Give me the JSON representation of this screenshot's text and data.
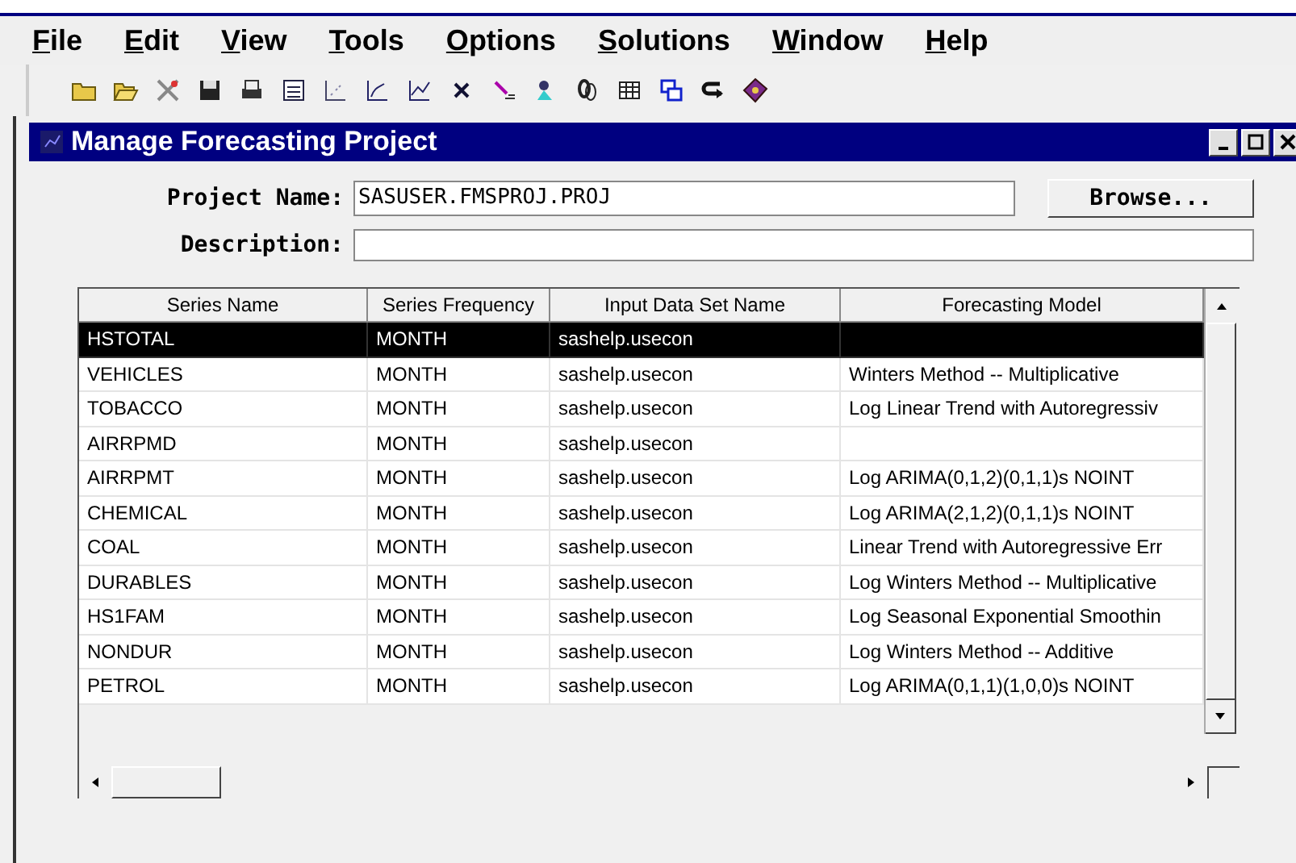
{
  "menu": [
    "File",
    "Edit",
    "View",
    "Tools",
    "Options",
    "Solutions",
    "Window",
    "Help"
  ],
  "window": {
    "title": "Manage Forecasting Project"
  },
  "project_name": {
    "label": "Project Name:",
    "value": "SASUSER.FMSPROJ.PROJ"
  },
  "browse_button": "Browse...",
  "description": {
    "label": "Description:"
  },
  "table": {
    "columns": [
      "Series Name",
      "Series Frequency",
      "Input Data Set Name",
      "Forecasting Model"
    ],
    "rows": [
      {
        "cells": [
          "HSTOTAL",
          "MONTH",
          "sashelp.usecon",
          ""
        ],
        "selected": true
      },
      {
        "cells": [
          "VEHICLES",
          "MONTH",
          "sashelp.usecon",
          "Winters Method -- Multiplicative"
        ],
        "selected": false
      },
      {
        "cells": [
          "TOBACCO",
          "MONTH",
          "sashelp.usecon",
          "Log Linear Trend with Autoregressiv"
        ],
        "selected": false
      },
      {
        "cells": [
          "AIRRPMD",
          "MONTH",
          "sashelp.usecon",
          ""
        ],
        "selected": false
      },
      {
        "cells": [
          "AIRRPMT",
          "MONTH",
          "sashelp.usecon",
          "Log ARIMA(0,1,2)(0,1,1)s NOINT"
        ],
        "selected": false
      },
      {
        "cells": [
          "CHEMICAL",
          "MONTH",
          "sashelp.usecon",
          "Log ARIMA(2,1,2)(0,1,1)s NOINT"
        ],
        "selected": false
      },
      {
        "cells": [
          "COAL",
          "MONTH",
          "sashelp.usecon",
          "Linear Trend with Autoregressive Err"
        ],
        "selected": false
      },
      {
        "cells": [
          "DURABLES",
          "MONTH",
          "sashelp.usecon",
          "Log Winters Method -- Multiplicative"
        ],
        "selected": false
      },
      {
        "cells": [
          "HS1FAM",
          "MONTH",
          "sashelp.usecon",
          "Log Seasonal Exponential Smoothin"
        ],
        "selected": false
      },
      {
        "cells": [
          "NONDUR",
          "MONTH",
          "sashelp.usecon",
          "Log Winters Method -- Additive"
        ],
        "selected": false
      },
      {
        "cells": [
          "PETROL",
          "MONTH",
          "sashelp.usecon",
          "Log ARIMA(0,1,1)(1,0,0)s NOINT"
        ],
        "selected": false
      }
    ]
  }
}
